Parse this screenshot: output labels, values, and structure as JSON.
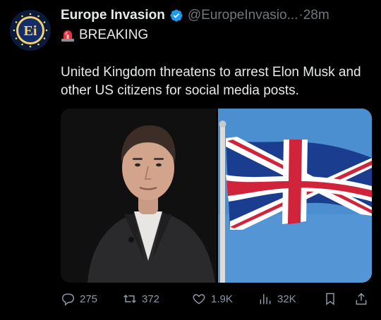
{
  "tweet": {
    "author": {
      "name": "Europe Invasion",
      "handle": "@EuropeInvasio...",
      "time": "28m",
      "separator": "·",
      "avatar_text": "Ei",
      "verified": true,
      "verified_color": "#1d9bf0"
    },
    "more_label": "···",
    "header_line": {
      "icon": "siren-icon",
      "text": "BREAKING"
    },
    "text": "United Kingdom threatens to arrest Elon Musk and other US citizens for social media posts.",
    "media": [
      {
        "name": "portrait-photo",
        "icon": "photo-icon"
      },
      {
        "name": "flag-photo",
        "icon": "union-jack-flag"
      }
    ]
  },
  "actions": {
    "replies": "275",
    "reposts": "372",
    "likes": "1.9K",
    "views": "32K"
  },
  "colors": {
    "background": "#000000",
    "text": "#e7e9ea",
    "muted": "#71767b",
    "accent": "#1d9bf0"
  }
}
